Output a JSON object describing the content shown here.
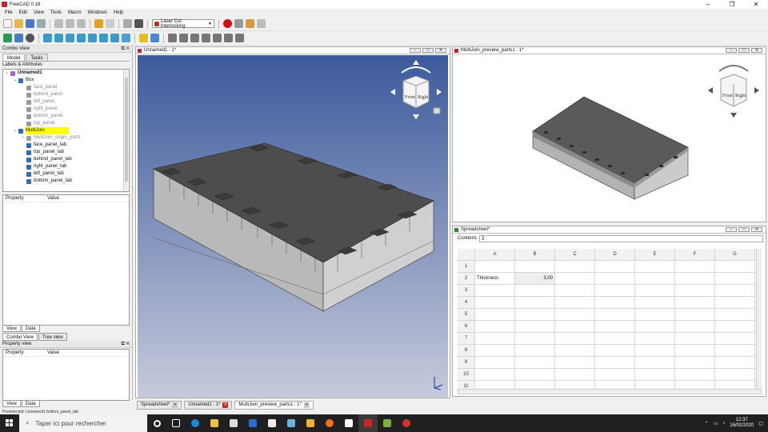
{
  "window": {
    "title": "FreeCAD 0.18"
  },
  "menu": [
    "File",
    "Edit",
    "View",
    "Tools",
    "Macro",
    "Windows",
    "Help"
  ],
  "toolbar": {
    "workbench": "Laser Cut Interlocking"
  },
  "combo_view": {
    "title": "Combo View",
    "tabs": [
      "Model",
      "Tasks"
    ],
    "labels_header": "Labels & Attributes",
    "tree": [
      {
        "label": "Unnamed1",
        "level": 0,
        "bold": true,
        "type": "doc"
      },
      {
        "label": "Box",
        "level": 1,
        "bold": false,
        "type": "part"
      },
      {
        "label": "face_panel",
        "level": 2,
        "grey": true,
        "type": "grey"
      },
      {
        "label": "behind_panel",
        "level": 2,
        "grey": true,
        "type": "grey"
      },
      {
        "label": "left_panel",
        "level": 2,
        "grey": true,
        "type": "grey"
      },
      {
        "label": "right_panel",
        "level": 2,
        "grey": true,
        "type": "grey"
      },
      {
        "label": "bottom_panel",
        "level": 2,
        "grey": true,
        "type": "grey"
      },
      {
        "label": "top_panel",
        "level": 2,
        "grey": true,
        "type": "grey"
      },
      {
        "label": "MultiJoin",
        "level": 1,
        "highlight": true,
        "type": "part"
      },
      {
        "label": "MultiJoin_origin_parts",
        "level": 2,
        "grey": true,
        "type": "folder"
      },
      {
        "label": "face_panel_tab",
        "level": 2,
        "type": "blue"
      },
      {
        "label": "top_panel_tab",
        "level": 2,
        "type": "blue"
      },
      {
        "label": "behind_panel_tab",
        "level": 2,
        "type": "blue"
      },
      {
        "label": "right_panel_tab",
        "level": 2,
        "type": "blue"
      },
      {
        "label": "left_panel_tab",
        "level": 2,
        "type": "blue"
      },
      {
        "label": "bottom_panel_tab",
        "level": 2,
        "type": "blue"
      }
    ],
    "prop_header": [
      "Property",
      "Value"
    ],
    "bottom_tabs": [
      "View",
      "Data"
    ],
    "lower_tabs": [
      "Combo View",
      "Tree view"
    ]
  },
  "property_view": {
    "title": "Property view",
    "header": [
      "Property",
      "Value"
    ],
    "bottom_tabs": [
      "View",
      "Data"
    ]
  },
  "views": {
    "unnamed": {
      "title": "Unnamed1 : 1*"
    },
    "preview": {
      "title": "MultiJoin_preview_parts1 : 1*"
    },
    "spreadsheet": {
      "title": "Spreadsheet*"
    }
  },
  "navcube": {
    "front": "Front",
    "right": "Right"
  },
  "spreadsheet": {
    "contents_label": "Contents",
    "contents_value": "3",
    "columns": [
      "A",
      "B",
      "C",
      "D",
      "E",
      "F",
      "G"
    ],
    "rows": [
      "1",
      "2",
      "3",
      "4",
      "5",
      "6",
      "7",
      "8",
      "9",
      "10",
      "11"
    ],
    "cells": {
      "A2": "Thickness",
      "B2": "3,00"
    }
  },
  "doc_tabs": [
    "Spreadsheet*",
    "Unnamed1 : 1*",
    "MultiJoin_preview_parts1 : 1*"
  ],
  "status": {
    "text": "Preselected: Unnamed1.bottom_panel_tab"
  },
  "taskbar": {
    "search_placeholder": "Taper ici pour rechercher",
    "time": "12:37",
    "date": "16/02/2020"
  },
  "colors": {
    "highlight": "#ffff00",
    "viewport_top": "#3c5a9c",
    "viewport_bottom": "#c6cadb",
    "tree_blue": "#2e6cc4"
  }
}
